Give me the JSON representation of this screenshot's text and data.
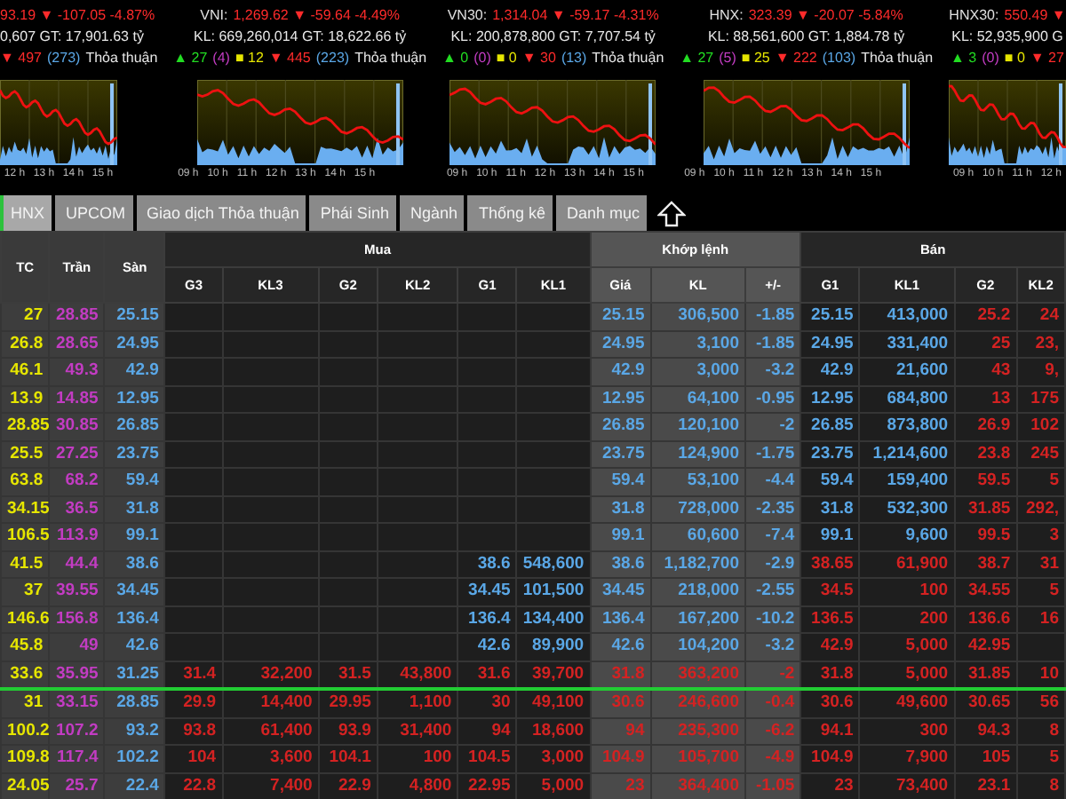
{
  "indices": [
    {
      "headline": [
        {
          "kind": "down",
          "text": "93.19 ▼ -107.05 -4.87%"
        }
      ],
      "volume": "0,607 GT: 17,901.63 tỷ",
      "breadth": [
        {
          "kind": "down",
          "text": "▼ 497"
        },
        {
          "kind": "floor",
          "text": "(273)"
        },
        {
          "kind": "label",
          "text": "Thỏa thuận"
        }
      ],
      "axis": [
        "12 h",
        "13 h",
        "14 h",
        "15 h"
      ]
    },
    {
      "headline": [
        {
          "kind": "name",
          "text": "VNI:"
        },
        {
          "kind": "down",
          "text": "1,269.62 ▼ -59.64 -4.49%"
        }
      ],
      "volume": "KL: 669,260,014 GT: 18,622.66 tỷ",
      "breadth": [
        {
          "kind": "up",
          "text": "▲ 27"
        },
        {
          "kind": "ceiling",
          "text": "(4)"
        },
        {
          "kind": "ref",
          "text": "■ 12"
        },
        {
          "kind": "down",
          "text": "▼ 445"
        },
        {
          "kind": "floor",
          "text": "(223)"
        },
        {
          "kind": "label",
          "text": "Thỏa thuận"
        }
      ],
      "axis": [
        "09 h",
        "10 h",
        "11 h",
        "12 h",
        "13 h",
        "14 h",
        "15 h"
      ]
    },
    {
      "headline": [
        {
          "kind": "name",
          "text": "VN30:"
        },
        {
          "kind": "down",
          "text": "1,314.04 ▼ -59.17 -4.31%"
        }
      ],
      "volume": "KL: 200,878,800 GT: 7,707.54 tỷ",
      "breadth": [
        {
          "kind": "up",
          "text": "▲ 0"
        },
        {
          "kind": "ceiling",
          "text": "(0)"
        },
        {
          "kind": "ref",
          "text": "■ 0"
        },
        {
          "kind": "down",
          "text": "▼ 30"
        },
        {
          "kind": "floor",
          "text": "(13)"
        },
        {
          "kind": "label",
          "text": "Thỏa thuận"
        }
      ],
      "axis": [
        "09 h",
        "10 h",
        "11 h",
        "12 h",
        "13 h",
        "14 h",
        "15 h"
      ]
    },
    {
      "headline": [
        {
          "kind": "name",
          "text": "HNX:"
        },
        {
          "kind": "down",
          "text": "323.39 ▼ -20.07 -5.84%"
        }
      ],
      "volume": "KL: 88,561,600 GT: 1,884.78 tỷ",
      "breadth": [
        {
          "kind": "up",
          "text": "▲ 27"
        },
        {
          "kind": "ceiling",
          "text": "(5)"
        },
        {
          "kind": "ref",
          "text": "■ 25"
        },
        {
          "kind": "down",
          "text": "▼ 222"
        },
        {
          "kind": "floor",
          "text": "(103)"
        },
        {
          "kind": "label",
          "text": "Thỏa thuận"
        }
      ],
      "axis": [
        "09 h",
        "10 h",
        "11 h",
        "12 h",
        "13 h",
        "14 h",
        "15 h"
      ]
    },
    {
      "headline": [
        {
          "kind": "name",
          "text": "HNX30:"
        },
        {
          "kind": "down",
          "text": "550.49 ▼"
        }
      ],
      "volume": "KL: 52,935,900 G",
      "breadth": [
        {
          "kind": "up",
          "text": "▲ 3"
        },
        {
          "kind": "ceiling",
          "text": "(0)"
        },
        {
          "kind": "ref",
          "text": "■ 0"
        },
        {
          "kind": "down",
          "text": "▼ 27"
        }
      ],
      "axis": [
        "09 h",
        "10 h",
        "11 h",
        "12 h"
      ]
    }
  ],
  "tabs": [
    {
      "label": "HNX",
      "selected": true
    },
    {
      "label": "UPCOM",
      "selected": false
    },
    {
      "label": "Giao dịch Thỏa thuận",
      "selected": false
    },
    {
      "label": "Phái Sinh",
      "selected": false
    },
    {
      "label": "Ngành",
      "selected": false
    },
    {
      "label": "Thống kê",
      "selected": false
    },
    {
      "label": "Danh mục",
      "selected": false
    }
  ],
  "board": {
    "fixed_columns": [
      "TC",
      "Trần",
      "Sàn"
    ],
    "groups": [
      {
        "kind": "buy",
        "label": "Mua",
        "columns": [
          "G3",
          "KL3",
          "G2",
          "KL2",
          "G1",
          "KL1"
        ]
      },
      {
        "kind": "match",
        "label": "Khớp lệnh",
        "columns": [
          "Giá",
          "KL",
          "+/-"
        ]
      },
      {
        "kind": "sell",
        "label": "Bán",
        "columns": [
          "G1",
          "KL1",
          "G2",
          "KL2"
        ]
      }
    ],
    "rows": [
      {
        "tc": "27",
        "ceiling": "28.85",
        "floor": "25.15",
        "buy": {
          "cells": [
            null,
            null,
            null,
            null,
            null,
            null
          ]
        },
        "match": {
          "color": "#5aa7e6",
          "cells": [
            "25.15",
            "306,500",
            "-1.85"
          ]
        },
        "sell": [
          {
            "color": "#5aa7e6",
            "cells": [
              "25.15",
              "413,000"
            ]
          },
          {
            "color": "#d42222",
            "cells": [
              "25.2",
              "24"
            ]
          }
        ],
        "separator_below": false
      },
      {
        "tc": "26.8",
        "ceiling": "28.65",
        "floor": "24.95",
        "buy": {
          "cells": [
            null,
            null,
            null,
            null,
            null,
            null
          ]
        },
        "match": {
          "color": "#5aa7e6",
          "cells": [
            "24.95",
            "3,100",
            "-1.85"
          ]
        },
        "sell": [
          {
            "color": "#5aa7e6",
            "cells": [
              "24.95",
              "331,400"
            ]
          },
          {
            "color": "#d42222",
            "cells": [
              "25",
              "23,"
            ]
          }
        ],
        "separator_below": false
      },
      {
        "tc": "46.1",
        "ceiling": "49.3",
        "floor": "42.9",
        "buy": {
          "cells": [
            null,
            null,
            null,
            null,
            null,
            null
          ]
        },
        "match": {
          "color": "#5aa7e6",
          "cells": [
            "42.9",
            "3,000",
            "-3.2"
          ]
        },
        "sell": [
          {
            "color": "#5aa7e6",
            "cells": [
              "42.9",
              "21,600"
            ]
          },
          {
            "color": "#d42222",
            "cells": [
              "43",
              "9,"
            ]
          }
        ],
        "separator_below": false
      },
      {
        "tc": "13.9",
        "ceiling": "14.85",
        "floor": "12.95",
        "buy": {
          "cells": [
            null,
            null,
            null,
            null,
            null,
            null
          ]
        },
        "match": {
          "color": "#5aa7e6",
          "cells": [
            "12.95",
            "64,100",
            "-0.95"
          ]
        },
        "sell": [
          {
            "color": "#5aa7e6",
            "cells": [
              "12.95",
              "684,800"
            ]
          },
          {
            "color": "#d42222",
            "cells": [
              "13",
              "175"
            ]
          }
        ],
        "separator_below": false
      },
      {
        "tc": "28.85",
        "ceiling": "30.85",
        "floor": "26.85",
        "buy": {
          "cells": [
            null,
            null,
            null,
            null,
            null,
            null
          ]
        },
        "match": {
          "color": "#5aa7e6",
          "cells": [
            "26.85",
            "120,100",
            "-2"
          ]
        },
        "sell": [
          {
            "color": "#5aa7e6",
            "cells": [
              "26.85",
              "873,800"
            ]
          },
          {
            "color": "#d42222",
            "cells": [
              "26.9",
              "102"
            ]
          }
        ],
        "separator_below": false
      },
      {
        "tc": "25.5",
        "ceiling": "27.25",
        "floor": "23.75",
        "buy": {
          "cells": [
            null,
            null,
            null,
            null,
            null,
            null
          ]
        },
        "match": {
          "color": "#5aa7e6",
          "cells": [
            "23.75",
            "124,900",
            "-1.75"
          ]
        },
        "sell": [
          {
            "color": "#5aa7e6",
            "cells": [
              "23.75",
              "1,214,600"
            ]
          },
          {
            "color": "#d42222",
            "cells": [
              "23.8",
              "245"
            ]
          }
        ],
        "separator_below": false
      },
      {
        "tc": "63.8",
        "ceiling": "68.2",
        "floor": "59.4",
        "buy": {
          "cells": [
            null,
            null,
            null,
            null,
            null,
            null
          ]
        },
        "match": {
          "color": "#5aa7e6",
          "cells": [
            "59.4",
            "53,100",
            "-4.4"
          ]
        },
        "sell": [
          {
            "color": "#5aa7e6",
            "cells": [
              "59.4",
              "159,400"
            ]
          },
          {
            "color": "#d42222",
            "cells": [
              "59.5",
              "5"
            ]
          }
        ],
        "separator_below": false
      },
      {
        "tc": "34.15",
        "ceiling": "36.5",
        "floor": "31.8",
        "buy": {
          "cells": [
            null,
            null,
            null,
            null,
            null,
            null
          ]
        },
        "match": {
          "color": "#5aa7e6",
          "cells": [
            "31.8",
            "728,000",
            "-2.35"
          ]
        },
        "sell": [
          {
            "color": "#5aa7e6",
            "cells": [
              "31.8",
              "532,300"
            ]
          },
          {
            "color": "#d42222",
            "cells": [
              "31.85",
              "292,"
            ]
          }
        ],
        "separator_below": false
      },
      {
        "tc": "106.5",
        "ceiling": "113.9",
        "floor": "99.1",
        "buy": {
          "cells": [
            null,
            null,
            null,
            null,
            null,
            null
          ]
        },
        "match": {
          "color": "#5aa7e6",
          "cells": [
            "99.1",
            "60,600",
            "-7.4"
          ]
        },
        "sell": [
          {
            "color": "#5aa7e6",
            "cells": [
              "99.1",
              "9,600"
            ]
          },
          {
            "color": "#d42222",
            "cells": [
              "99.5",
              "3"
            ]
          }
        ],
        "separator_below": false
      },
      {
        "tc": "41.5",
        "ceiling": "44.4",
        "floor": "38.6",
        "buy": {
          "color": "#5aa7e6",
          "cells": [
            null,
            null,
            null,
            null,
            "38.6",
            "548,600"
          ]
        },
        "match": {
          "color": "#5aa7e6",
          "cells": [
            "38.6",
            "1,182,700",
            "-2.9"
          ]
        },
        "sell": [
          {
            "color": "#d42222",
            "cells": [
              "38.65",
              "61,900"
            ]
          },
          {
            "color": "#d42222",
            "cells": [
              "38.7",
              "31"
            ]
          }
        ],
        "separator_below": false
      },
      {
        "tc": "37",
        "ceiling": "39.55",
        "floor": "34.45",
        "buy": {
          "color": "#5aa7e6",
          "cells": [
            null,
            null,
            null,
            null,
            "34.45",
            "101,500"
          ]
        },
        "match": {
          "color": "#5aa7e6",
          "cells": [
            "34.45",
            "218,000",
            "-2.55"
          ]
        },
        "sell": [
          {
            "color": "#d42222",
            "cells": [
              "34.5",
              "100"
            ]
          },
          {
            "color": "#d42222",
            "cells": [
              "34.55",
              "5"
            ]
          }
        ],
        "separator_below": false
      },
      {
        "tc": "146.6",
        "ceiling": "156.8",
        "floor": "136.4",
        "buy": {
          "color": "#5aa7e6",
          "cells": [
            null,
            null,
            null,
            null,
            "136.4",
            "134,400"
          ]
        },
        "match": {
          "color": "#5aa7e6",
          "cells": [
            "136.4",
            "167,200",
            "-10.2"
          ]
        },
        "sell": [
          {
            "color": "#d42222",
            "cells": [
              "136.5",
              "200"
            ]
          },
          {
            "color": "#d42222",
            "cells": [
              "136.6",
              "16"
            ]
          }
        ],
        "separator_below": false
      },
      {
        "tc": "45.8",
        "ceiling": "49",
        "floor": "42.6",
        "buy": {
          "color": "#5aa7e6",
          "cells": [
            null,
            null,
            null,
            null,
            "42.6",
            "89,900"
          ]
        },
        "match": {
          "color": "#5aa7e6",
          "cells": [
            "42.6",
            "104,200",
            "-3.2"
          ]
        },
        "sell": [
          {
            "color": "#d42222",
            "cells": [
              "42.9",
              "5,000"
            ]
          },
          {
            "color": "#d42222",
            "cells": [
              "42.95",
              null
            ]
          }
        ],
        "separator_below": false
      },
      {
        "tc": "33.6",
        "ceiling": "35.95",
        "floor": "31.25",
        "buy": {
          "color": "#d42222",
          "cells": [
            "31.4",
            "32,200",
            "31.5",
            "43,800",
            "31.6",
            "39,700"
          ]
        },
        "match": {
          "color": "#d42222",
          "cells": [
            "31.8",
            "363,200",
            "-2"
          ]
        },
        "sell": [
          {
            "color": "#d42222",
            "cells": [
              "31.8",
              "5,000"
            ]
          },
          {
            "color": "#d42222",
            "cells": [
              "31.85",
              "10"
            ]
          }
        ],
        "separator_below": true
      },
      {
        "tc": "31",
        "ceiling": "33.15",
        "floor": "28.85",
        "buy": {
          "color": "#d42222",
          "cells": [
            "29.9",
            "14,400",
            "29.95",
            "1,100",
            "30",
            "49,100"
          ]
        },
        "match": {
          "color": "#d42222",
          "cells": [
            "30.6",
            "246,600",
            "-0.4"
          ]
        },
        "sell": [
          {
            "color": "#d42222",
            "cells": [
              "30.6",
              "49,600"
            ]
          },
          {
            "color": "#d42222",
            "cells": [
              "30.65",
              "56"
            ]
          }
        ],
        "separator_below": false
      },
      {
        "tc": "100.2",
        "ceiling": "107.2",
        "floor": "93.2",
        "buy": {
          "color": "#d42222",
          "cells": [
            "93.8",
            "61,400",
            "93.9",
            "31,400",
            "94",
            "18,600"
          ]
        },
        "match": {
          "color": "#d42222",
          "cells": [
            "94",
            "235,300",
            "-6.2"
          ]
        },
        "sell": [
          {
            "color": "#d42222",
            "cells": [
              "94.1",
              "300"
            ]
          },
          {
            "color": "#d42222",
            "cells": [
              "94.3",
              "8"
            ]
          }
        ],
        "separator_below": false
      },
      {
        "tc": "109.8",
        "ceiling": "117.4",
        "floor": "102.2",
        "buy": {
          "color": "#d42222",
          "cells": [
            "104",
            "3,600",
            "104.1",
            "100",
            "104.5",
            "3,000"
          ]
        },
        "match": {
          "color": "#d42222",
          "cells": [
            "104.9",
            "105,700",
            "-4.9"
          ]
        },
        "sell": [
          {
            "color": "#d42222",
            "cells": [
              "104.9",
              "7,900"
            ]
          },
          {
            "color": "#d42222",
            "cells": [
              "105",
              "5"
            ]
          }
        ],
        "separator_below": false
      },
      {
        "tc": "24.05",
        "ceiling": "25.7",
        "floor": "22.4",
        "buy": {
          "color": "#d42222",
          "cells": [
            "22.8",
            "7,400",
            "22.9",
            "4,800",
            "22.95",
            "5,000"
          ]
        },
        "match": {
          "color": "#d42222",
          "cells": [
            "23",
            "364,400",
            "-1.05"
          ]
        },
        "sell": [
          {
            "color": "#d42222",
            "cells": [
              "23",
              "73,400"
            ]
          },
          {
            "color": "#d42222",
            "cells": [
              "23.1",
              "8"
            ]
          }
        ],
        "separator_below": false
      }
    ]
  }
}
